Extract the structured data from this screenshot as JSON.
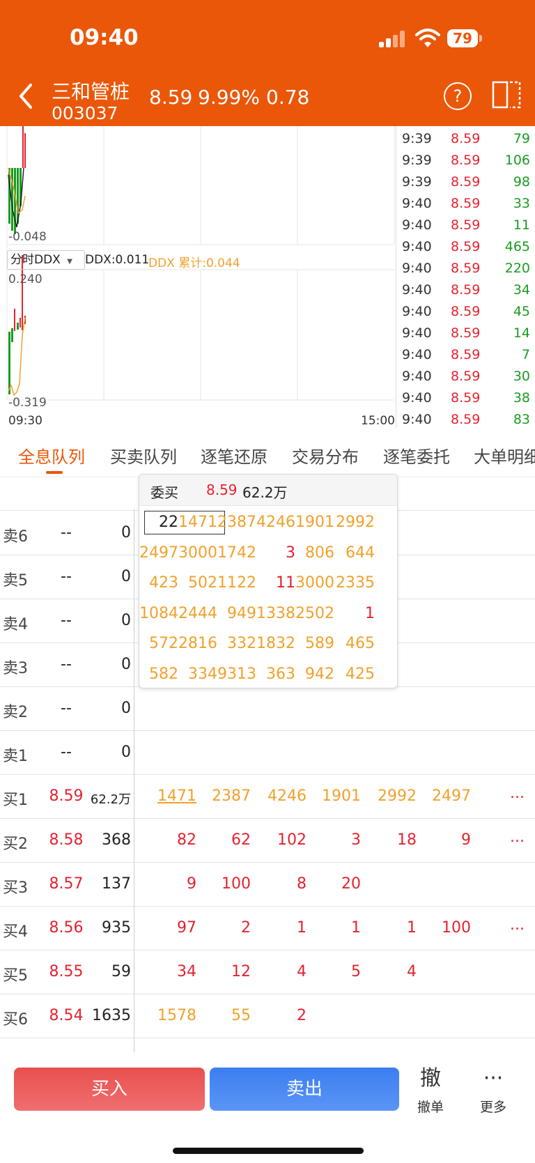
{
  "status_bar": {
    "time": "09:40",
    "battery": "79"
  },
  "header": {
    "name": "三和管桩",
    "code": "003037",
    "price": "8.59",
    "change_pct": "9.99%",
    "change": "0.78"
  },
  "chart": {
    "upper_min": "-0.048",
    "ddx_selector": "分时DDX",
    "ddx_value": "DDX:0.011",
    "ddx_cum": "DDX 累计:0.044",
    "lower_max": "0.240",
    "lower_min": "-0.319",
    "time_start": "09:30",
    "time_end": "15:00"
  },
  "ticks": [
    {
      "time": "9:39",
      "price": "8.59",
      "vol": "79"
    },
    {
      "time": "9:39",
      "price": "8.59",
      "vol": "106"
    },
    {
      "time": "9:39",
      "price": "8.59",
      "vol": "98"
    },
    {
      "time": "9:40",
      "price": "8.59",
      "vol": "33"
    },
    {
      "time": "9:40",
      "price": "8.59",
      "vol": "11"
    },
    {
      "time": "9:40",
      "price": "8.59",
      "vol": "465"
    },
    {
      "time": "9:40",
      "price": "8.59",
      "vol": "220"
    },
    {
      "time": "9:40",
      "price": "8.59",
      "vol": "34"
    },
    {
      "time": "9:40",
      "price": "8.59",
      "vol": "45"
    },
    {
      "time": "9:40",
      "price": "8.59",
      "vol": "14"
    },
    {
      "time": "9:40",
      "price": "8.59",
      "vol": "7"
    },
    {
      "time": "9:40",
      "price": "8.59",
      "vol": "30"
    },
    {
      "time": "9:40",
      "price": "8.59",
      "vol": "38"
    },
    {
      "time": "9:40",
      "price": "8.59",
      "vol": "83"
    }
  ],
  "tabs": [
    "全息队列",
    "买卖队列",
    "逐笔还原",
    "交易分布",
    "逐笔委托",
    "大单明细"
  ],
  "popup": {
    "title": "委买",
    "price": "8.59",
    "volume": "62.2万",
    "rows": [
      [
        "22",
        "1471",
        "2387",
        "4246",
        "1901",
        "2992"
      ],
      [
        "2497",
        "3000",
        "1742",
        "3",
        "806",
        "644"
      ],
      [
        "423",
        "502",
        "1122",
        "11",
        "3000",
        "2335"
      ],
      [
        "1084",
        "2444",
        "949",
        "1338",
        "2502",
        "1"
      ],
      [
        "572",
        "2816",
        "332",
        "1832",
        "589",
        "465"
      ],
      [
        "582",
        "334",
        "9313",
        "363",
        "942",
        "425"
      ]
    ],
    "red_cells": [
      "1-3",
      "2-3",
      "3-5"
    ]
  },
  "sell_rows": [
    {
      "label": "卖6",
      "price": "--",
      "vol": "0"
    },
    {
      "label": "卖5",
      "price": "--",
      "vol": "0"
    },
    {
      "label": "卖4",
      "price": "--",
      "vol": "0"
    },
    {
      "label": "卖3",
      "price": "--",
      "vol": "0"
    },
    {
      "label": "卖2",
      "price": "--",
      "vol": "0"
    },
    {
      "label": "卖1",
      "price": "--",
      "vol": "0"
    }
  ],
  "buy_rows": [
    {
      "label": "买1",
      "price": "8.59",
      "vol": "62.2万",
      "queue": [
        "1471",
        "2387",
        "4246",
        "1901",
        "2992",
        "2497"
      ],
      "more": "...",
      "color": "orange"
    },
    {
      "label": "买2",
      "price": "8.58",
      "vol": "368",
      "queue": [
        "82",
        "62",
        "102",
        "3",
        "18",
        "9"
      ],
      "more": "...",
      "color": "red"
    },
    {
      "label": "买3",
      "price": "8.57",
      "vol": "137",
      "queue": [
        "9",
        "100",
        "8",
        "20"
      ],
      "more": "",
      "color": "red"
    },
    {
      "label": "买4",
      "price": "8.56",
      "vol": "935",
      "queue": [
        "97",
        "2",
        "1",
        "1",
        "1",
        "100"
      ],
      "more": "...",
      "color": "red"
    },
    {
      "label": "买5",
      "price": "8.55",
      "vol": "59",
      "queue": [
        "34",
        "12",
        "4",
        "5",
        "4"
      ],
      "more": "",
      "color": "red"
    },
    {
      "label": "买6",
      "price": "8.54",
      "vol": "1635",
      "queue": [
        "1578",
        "55",
        "2"
      ],
      "more": "",
      "color": "mixed"
    }
  ],
  "bottom": {
    "buy": "买入",
    "sell": "卖出",
    "cancel_icon": "撤",
    "cancel": "撤单",
    "more_icon": "···",
    "more": "更多"
  },
  "colors": {
    "header": "#ea5709",
    "up": "#e5222f",
    "down": "#1a9b21",
    "queue": "#f0a12b"
  }
}
